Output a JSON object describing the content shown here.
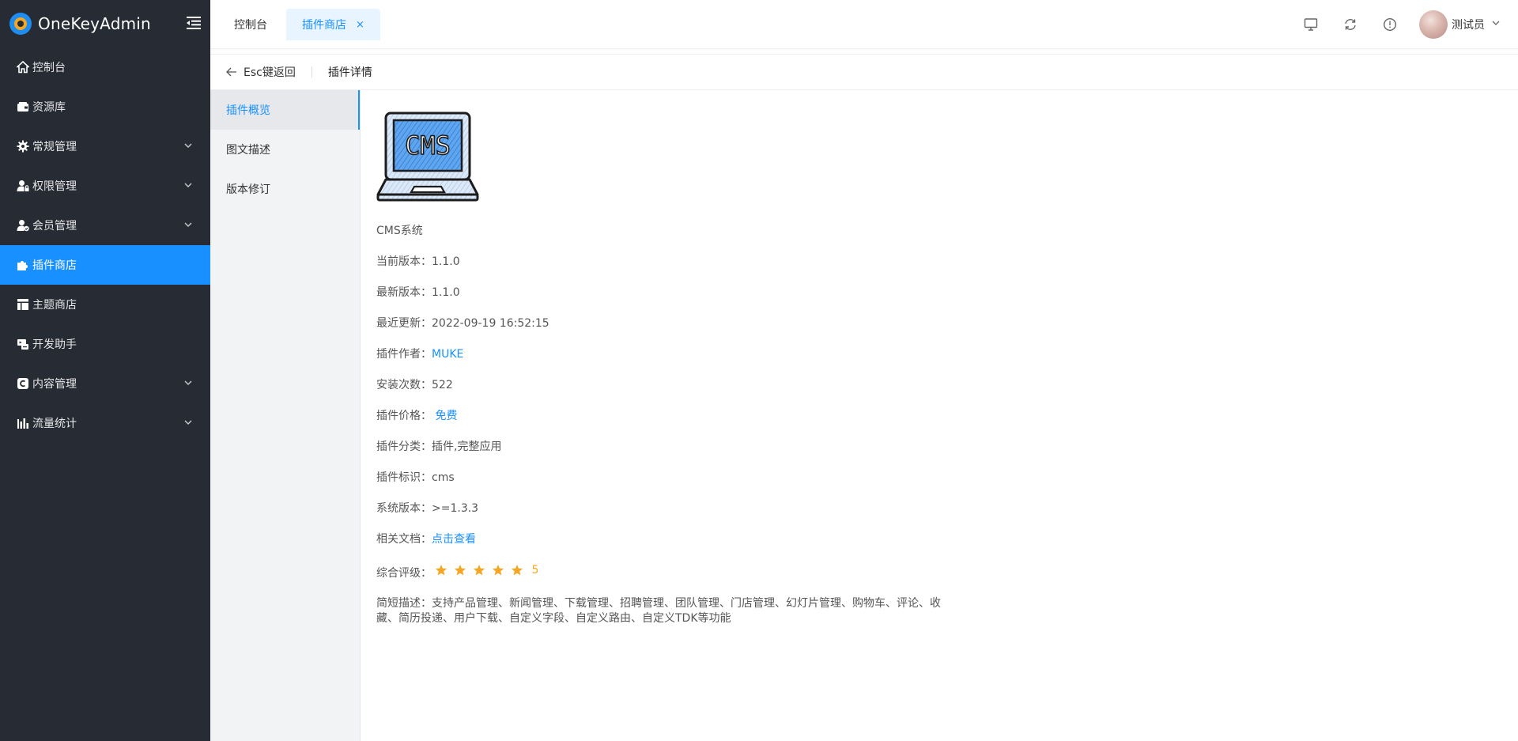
{
  "app": {
    "title": "OneKeyAdmin"
  },
  "sidebar": {
    "items": [
      {
        "label": "控制台",
        "icon": "home-icon",
        "expandable": false,
        "active": false
      },
      {
        "label": "资源库",
        "icon": "wallet-icon",
        "expandable": false,
        "active": false
      },
      {
        "label": "常规管理",
        "icon": "gear-icon",
        "expandable": true,
        "active": false
      },
      {
        "label": "权限管理",
        "icon": "user-lock-icon",
        "expandable": true,
        "active": false
      },
      {
        "label": "会员管理",
        "icon": "user-check-icon",
        "expandable": true,
        "active": false
      },
      {
        "label": "插件商店",
        "icon": "puzzle-icon",
        "expandable": false,
        "active": true
      },
      {
        "label": "主题商店",
        "icon": "layout-icon",
        "expandable": false,
        "active": false
      },
      {
        "label": "开发助手",
        "icon": "dev-icon",
        "expandable": false,
        "active": false
      },
      {
        "label": "内容管理",
        "icon": "copyright-icon",
        "expandable": true,
        "active": false
      },
      {
        "label": "流量统计",
        "icon": "bar-chart-icon",
        "expandable": true,
        "active": false
      }
    ]
  },
  "header": {
    "tabs": [
      {
        "label": "控制台",
        "active": false
      },
      {
        "label": "插件商店",
        "active": true,
        "close": "×"
      }
    ],
    "user": {
      "name": "测试员"
    }
  },
  "page": {
    "back_label": "Esc键返回",
    "title": "插件详情"
  },
  "subnav": {
    "items": [
      {
        "label": "插件概览",
        "active": true
      },
      {
        "label": "图文描述",
        "active": false
      },
      {
        "label": "版本修订",
        "active": false
      }
    ]
  },
  "plugin": {
    "image_text": "CMS",
    "name": "CMS系统",
    "current_version_label": "当前版本：",
    "current_version": "1.1.0",
    "latest_version_label": "最新版本：",
    "latest_version": "1.1.0",
    "updated_label": "最近更新：",
    "updated": "2022-09-19 16:52:15",
    "author_label": "插件作者：",
    "author": "MUKE",
    "installs_label": "安装次数：",
    "installs": "522",
    "price_label": "插件价格：",
    "price": "免费",
    "category_label": "插件分类：",
    "category": "插件,完整应用",
    "identifier_label": "插件标识：",
    "identifier": "cms",
    "sys_version_label": "系统版本：",
    "sys_version": ">=1.3.3",
    "docs_label": "相关文档：",
    "docs_link": "点击查看",
    "rating_label": "综合评级：",
    "rating": 5,
    "rating_text": "5",
    "desc_label": "简短描述：",
    "desc": "支持产品管理、新闻管理、下载管理、招聘管理、团队管理、门店管理、幻灯片管理、购物车、评论、收藏、简历投递、用户下载、自定义字段、自定义路由、自定义TDK等功能"
  },
  "colors": {
    "sidebar_bg": "#262b34",
    "accent": "#1890ff",
    "star": "#f5a623"
  }
}
